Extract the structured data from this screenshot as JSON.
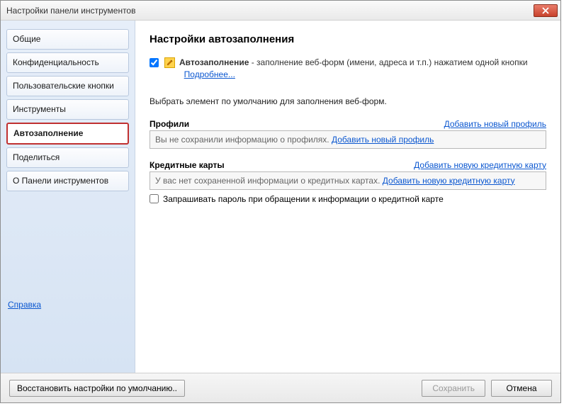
{
  "window": {
    "title": "Настройки панели инструментов"
  },
  "sidebar": {
    "items": [
      {
        "label": "Общие"
      },
      {
        "label": "Конфиденциальность"
      },
      {
        "label": "Пользовательские кнопки"
      },
      {
        "label": "Инструменты"
      },
      {
        "label": "Автозаполнение"
      },
      {
        "label": "Поделиться"
      },
      {
        "label": "О Панели инструментов"
      }
    ],
    "help": "Справка"
  },
  "content": {
    "title": "Настройки автозаполнения",
    "autofill": {
      "checked": true,
      "bold_label": "Автозаполнение",
      "desc": " - заполнение веб-форм (имени, адреса и т.п.) нажатием одной кнопки",
      "more": "Подробнее..."
    },
    "default_text": "Выбрать элемент по умолчанию для заполнения веб-форм.",
    "profiles": {
      "label": "Профили",
      "add_link": "Добавить новый профиль",
      "empty_text": "Вы не сохранили информацию о профилях.",
      "empty_add": "Добавить новый профиль"
    },
    "cards": {
      "label": "Кредитные карты",
      "add_link": "Добавить новую кредитную карту",
      "empty_text": "У вас нет сохраненной информации о кредитных картах.",
      "empty_add": "Добавить новую кредитную карту",
      "password_label": "Запрашивать пароль при обращении к информации о кредитной карте",
      "password_checked": false
    }
  },
  "footer": {
    "restore": "Восстановить настройки по умолчанию..",
    "save": "Сохранить",
    "cancel": "Отмена"
  }
}
